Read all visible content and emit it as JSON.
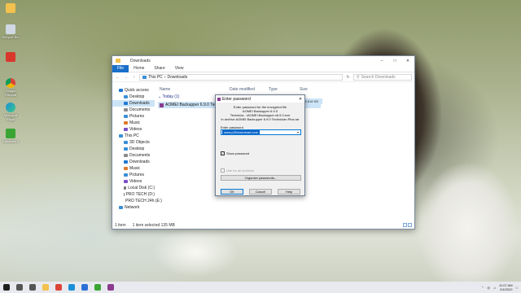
{
  "desktop": {
    "icons": [
      {
        "label": "",
        "icon": "user-folder-icon"
      },
      {
        "label": "Recycle Bin",
        "icon": "recycle-bin-icon"
      },
      {
        "label": "",
        "icon": "app-icon"
      },
      {
        "label": "Google Chrome",
        "icon": "chrome-icon"
      },
      {
        "label": "Microsoft Edge",
        "icon": "edge-icon"
      },
      {
        "label": "Camtasia 9",
        "icon": "camtasia-icon"
      }
    ]
  },
  "explorer": {
    "title": "Downloads",
    "ribbon_tabs": [
      "File",
      "Home",
      "Share",
      "View"
    ],
    "breadcrumb": [
      "This PC",
      "Downloads"
    ],
    "search_placeholder": "Search Downloads",
    "sidebar": [
      {
        "label": "Quick access",
        "indent": false,
        "selected": false,
        "color": "#1e78d4"
      },
      {
        "label": "Desktop",
        "indent": true,
        "selected": false,
        "color": "#3a8fd6"
      },
      {
        "label": "Downloads",
        "indent": true,
        "selected": true,
        "color": "#1e78d4"
      },
      {
        "label": "Documents",
        "indent": true,
        "selected": false,
        "color": "#8a8a8a"
      },
      {
        "label": "Pictures",
        "indent": true,
        "selected": false,
        "color": "#3a8fd6"
      },
      {
        "label": "Music",
        "indent": true,
        "selected": false,
        "color": "#e07a2a"
      },
      {
        "label": "Videos",
        "indent": true,
        "selected": false,
        "color": "#7a4fc6"
      },
      {
        "label": "This PC",
        "indent": false,
        "selected": false,
        "color": "#3a8fd6"
      },
      {
        "label": "3D Objects",
        "indent": true,
        "selected": false,
        "color": "#3a8fd6"
      },
      {
        "label": "Desktop",
        "indent": true,
        "selected": false,
        "color": "#3a8fd6"
      },
      {
        "label": "Documents",
        "indent": true,
        "selected": false,
        "color": "#8a8a8a"
      },
      {
        "label": "Downloads",
        "indent": true,
        "selected": false,
        "color": "#1e78d4"
      },
      {
        "label": "Music",
        "indent": true,
        "selected": false,
        "color": "#e07a2a"
      },
      {
        "label": "Pictures",
        "indent": true,
        "selected": false,
        "color": "#3a8fd6"
      },
      {
        "label": "Videos",
        "indent": true,
        "selected": false,
        "color": "#7a4fc6"
      },
      {
        "label": "Local Disk (C:)",
        "indent": true,
        "selected": false,
        "color": "#777777"
      },
      {
        "label": "PRO TECH (D:)",
        "indent": true,
        "selected": false,
        "color": "#777777"
      },
      {
        "label": "PRO TECH 24h (E:)",
        "indent": true,
        "selected": false,
        "color": "#777777"
      },
      {
        "label": "Network",
        "indent": false,
        "selected": false,
        "color": "#3a8fd6"
      }
    ],
    "columns": {
      "name": "Name",
      "date": "Date modified",
      "type": "Type",
      "size": "Size"
    },
    "group_label": "Today (1)",
    "file_name": "AOMEI Backupper 6.9.0 Technician",
    "status": {
      "items": "1 item",
      "selected": "1 item selected 135 MB"
    }
  },
  "dialog": {
    "title": "Enter password",
    "message_lines": [
      "Enter password for the encrypted file",
      "AOMEI Backupper 6.9.0 Technicia...\\AOMEI.Backupper.v6.9.0.exe",
      "in archive AOMEI Backupper 6.9.0 Technician.Plus.rar"
    ],
    "field_label": "Enter password",
    "password_value": "www.p30download.com",
    "show_password_label": "Show password",
    "use_all_label": "Use for all archives",
    "organize_label": "Organize passwords...",
    "buttons": {
      "ok": "OK",
      "cancel": "Cancel",
      "help": "Help"
    },
    "behind_text": "135,616 KB"
  },
  "taskbar": {
    "apps": [
      {
        "icon": "start-icon",
        "color": "#1f1f1f"
      },
      {
        "icon": "search-icon",
        "color": "#555555"
      },
      {
        "icon": "task-view-icon",
        "color": "#555555"
      },
      {
        "icon": "file-explorer-icon",
        "color": "#f2c14e"
      },
      {
        "icon": "chrome-icon",
        "color": "#db4437"
      },
      {
        "icon": "edge-icon",
        "color": "#1b8fd6"
      },
      {
        "icon": "store-icon",
        "color": "#2b6fd6"
      },
      {
        "icon": "camtasia-icon",
        "color": "#3aa534"
      },
      {
        "icon": "winrar-icon",
        "color": "#8a3b8e"
      }
    ],
    "time": "11:07 AM",
    "date": "2/4/2022"
  }
}
